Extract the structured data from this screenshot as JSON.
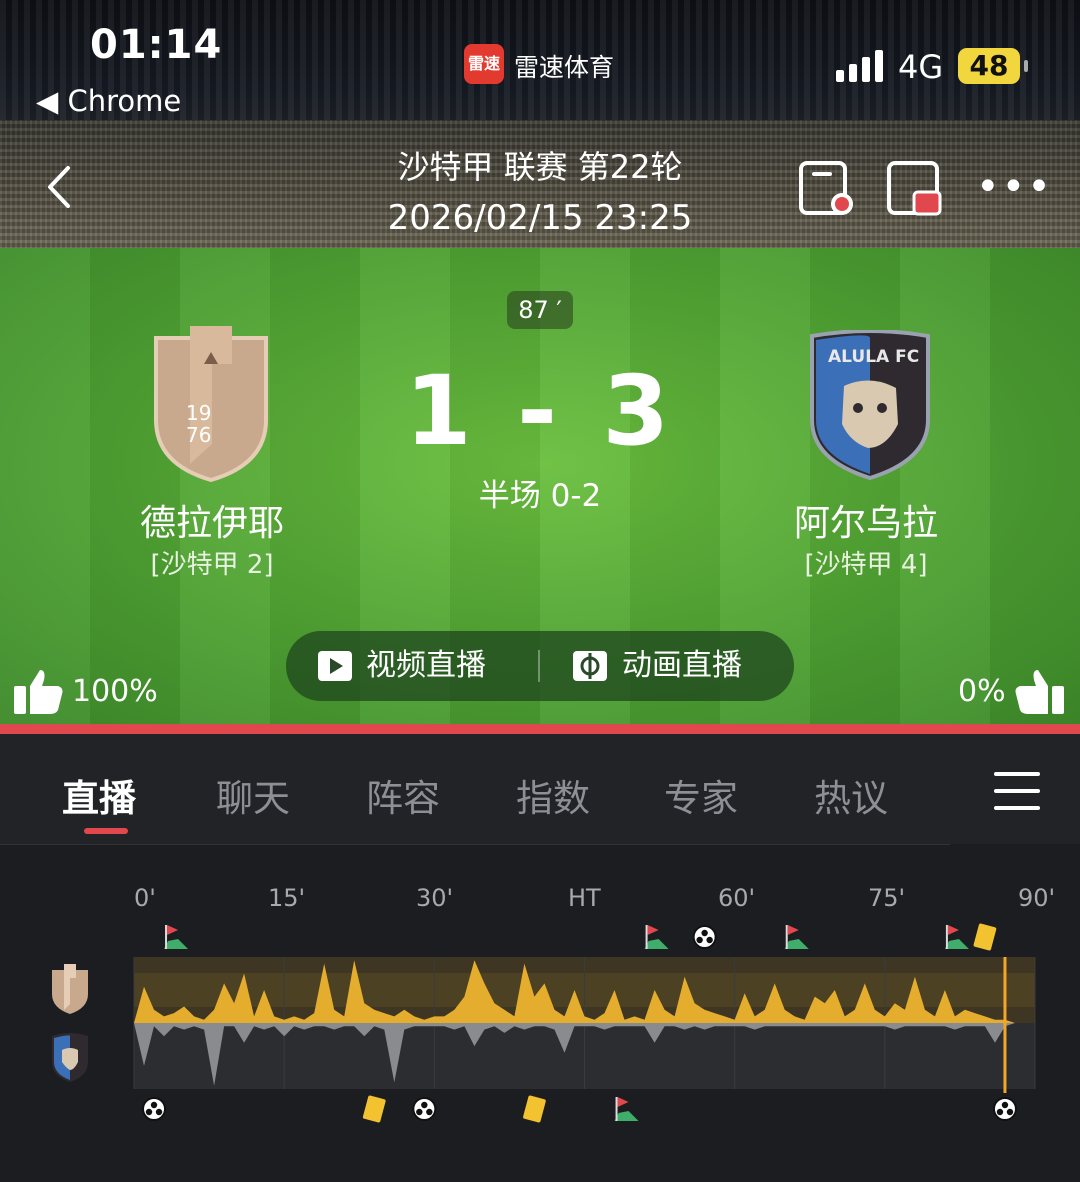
{
  "status_bar": {
    "time": "01:14",
    "back_app": "◀ Chrome",
    "network": "4G",
    "battery": "48"
  },
  "app": {
    "icon_text": "雷速",
    "name": "雷速体育"
  },
  "match": {
    "league": "沙特甲 联赛 第22轮",
    "datetime": "2026/02/15 23:25",
    "minute": "87 ′",
    "score": "1 - 3",
    "half_time": "半场 0-2",
    "home": {
      "name": "德拉伊耶",
      "rank": "[沙特甲 2]",
      "badge_text": "19\n76",
      "like": "100%"
    },
    "away": {
      "name": "阿尔乌拉",
      "rank": "[沙特甲 4]",
      "badge_text": "ALULA FC",
      "like": "0%"
    }
  },
  "live_buttons": {
    "video": "视频直播",
    "animation": "动画直播"
  },
  "tabs": [
    "直播",
    "聊天",
    "阵容",
    "指数",
    "专家",
    "热议"
  ],
  "timeline": {
    "ticks": [
      "0'",
      "15'",
      "30'",
      "HT",
      "60'",
      "75'",
      "90'"
    ],
    "colors": {
      "home": "#e5ad2e",
      "away": "#8a8b8f",
      "current": "#f2a62a"
    },
    "current_minute": 87,
    "home_events": [
      {
        "type": "corner",
        "minute": 4
      },
      {
        "type": "corner",
        "minute": 52
      },
      {
        "type": "goal",
        "minute": 57
      },
      {
        "type": "corner",
        "minute": 66
      },
      {
        "type": "corner",
        "minute": 82
      },
      {
        "type": "yellow",
        "minute": 85
      }
    ],
    "away_events": [
      {
        "type": "goal",
        "minute": 2
      },
      {
        "type": "yellow",
        "minute": 24
      },
      {
        "type": "goal",
        "minute": 29
      },
      {
        "type": "yellow",
        "minute": 40
      },
      {
        "type": "corner",
        "minute": 49
      },
      {
        "type": "goal",
        "minute": 87
      }
    ],
    "home_pressure": [
      0,
      0.55,
      0.2,
      0.1,
      0.15,
      0.25,
      0.1,
      0.05,
      0.2,
      0.6,
      0.3,
      0.75,
      0.1,
      0.5,
      0.1,
      0.05,
      0.1,
      0.05,
      0.15,
      0.9,
      0.2,
      0.1,
      0.95,
      0.3,
      0.2,
      0.15,
      0.1,
      0.2,
      0.1,
      0.05,
      0.1,
      0.1,
      0.2,
      0.4,
      0.95,
      0.6,
      0.3,
      0.2,
      0.1,
      0.9,
      0.4,
      0.6,
      0.2,
      0.1,
      0.5,
      0.1,
      0.05,
      0.15,
      0.5,
      0.05,
      0.1,
      0.05,
      0.5,
      0.2,
      0.1,
      0.7,
      0.3,
      0.2,
      0.15,
      0.1,
      0.05,
      0.45,
      0.1,
      0.2,
      0.6,
      0.2,
      0.1,
      0.05,
      0.4,
      0.3,
      0.5,
      0.1,
      0.2,
      0.6,
      0.2,
      0.1,
      0.3,
      0.2,
      0.7,
      0.2,
      0.1,
      0.5,
      0.1,
      0.2,
      0.15,
      0.1,
      0.05,
      0.05,
      0,
      0,
      0
    ],
    "away_pressure": [
      0,
      0.65,
      0.05,
      0.2,
      0.05,
      0.1,
      0.05,
      0.1,
      0.95,
      0.05,
      0.05,
      0.3,
      0.05,
      0.1,
      0.05,
      0.2,
      0.05,
      0.1,
      0.05,
      0.05,
      0.1,
      0.05,
      0.05,
      0.2,
      0.05,
      0.1,
      0.9,
      0.1,
      0.05,
      0.05,
      0.05,
      0.05,
      0.1,
      0.05,
      0.35,
      0.1,
      0.05,
      0.15,
      0.05,
      0.1,
      0.05,
      0.05,
      0.1,
      0.45,
      0.05,
      0.05,
      0.05,
      0.1,
      0.05,
      0.05,
      0.05,
      0.05,
      0.3,
      0.05,
      0.05,
      0.1,
      0.05,
      0.1,
      0.05,
      0.05,
      0.05,
      0.05,
      0.1,
      0.05,
      0.05,
      0.05,
      0.05,
      0.05,
      0.05,
      0.05,
      0.05,
      0.05,
      0.05,
      0.05,
      0.05,
      0.05,
      0.1,
      0.05,
      0.05,
      0.05,
      0.05,
      0.05,
      0.1,
      0.05,
      0.05,
      0.05,
      0.3,
      0.05,
      0,
      0,
      0
    ]
  }
}
